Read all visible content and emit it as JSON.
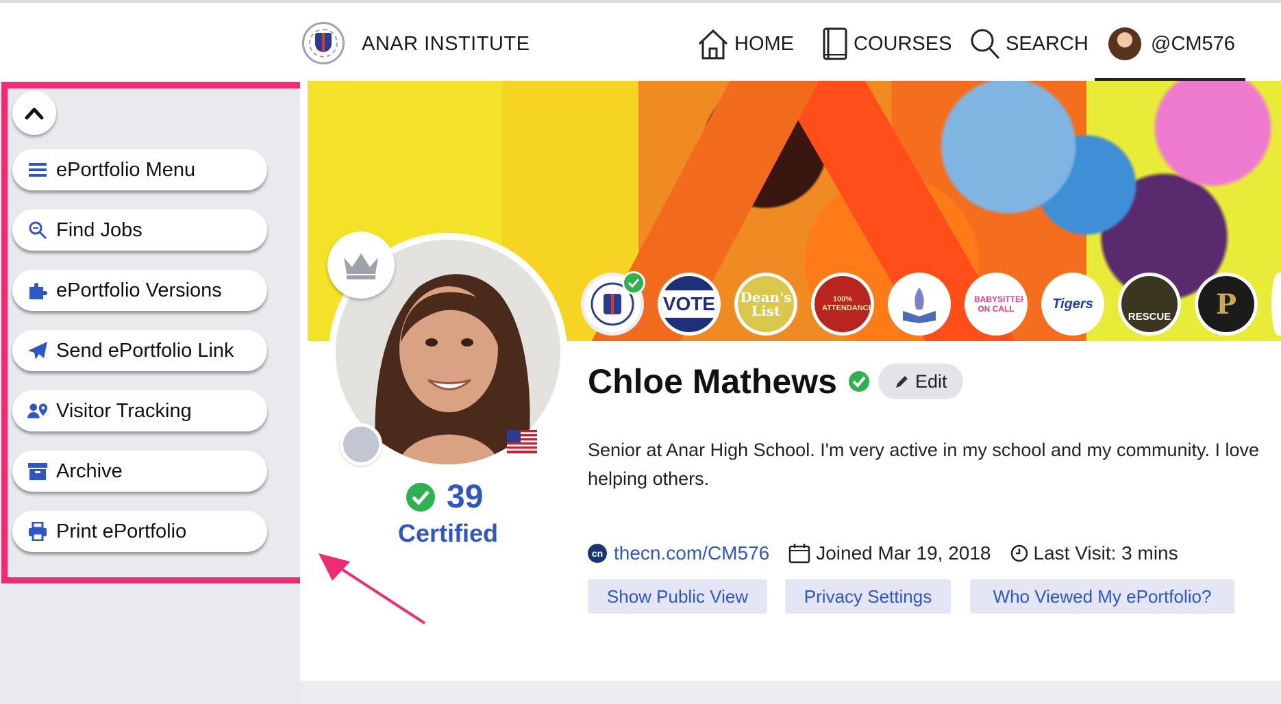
{
  "header": {
    "brand": "ANAR INSTITUTE",
    "nav": {
      "home": "HOME",
      "courses": "COURSES",
      "search": "SEARCH",
      "user": "@CM576"
    }
  },
  "sidebar": {
    "items": [
      {
        "label": "ePortfolio Menu",
        "icon": "menu-icon"
      },
      {
        "label": "Find Jobs",
        "icon": "search-jobs-icon"
      },
      {
        "label": "ePortfolio Versions",
        "icon": "puzzle-icon"
      },
      {
        "label": "Send ePortfolio Link",
        "icon": "paper-plane-icon"
      },
      {
        "label": "Visitor Tracking",
        "icon": "user-location-icon"
      },
      {
        "label": "Archive",
        "icon": "archive-icon"
      },
      {
        "label": "Print ePortfolio",
        "icon": "printer-icon"
      }
    ]
  },
  "profile": {
    "name": "Chloe Mathews",
    "edit_label": "Edit",
    "bio": "Senior at Anar High School. I'm very active in my school and my community. I love helping others.",
    "certified_count": "39",
    "certified_label": "Certified",
    "url": "thecn.com/CM576",
    "joined": "Joined Mar 19, 2018",
    "last_visit": "Last Visit: 3 mins",
    "buttons": {
      "public_view": "Show Public View",
      "privacy": "Privacy Settings",
      "who_viewed": "Who Viewed My ePortfolio?"
    }
  },
  "badges": {
    "vote": "VOTE",
    "deans_line1": "Dean's",
    "deans_line2": "List",
    "attendance": "100% ATTENDANCE",
    "babysitter": "BABYSITTER ON CALL",
    "tigers": "Tigers",
    "rescue": "RESCUE",
    "purdue": "P"
  },
  "colors": {
    "accent": "#2f57c4",
    "highlight": "#ef2b74",
    "verified": "#2fb14f"
  }
}
